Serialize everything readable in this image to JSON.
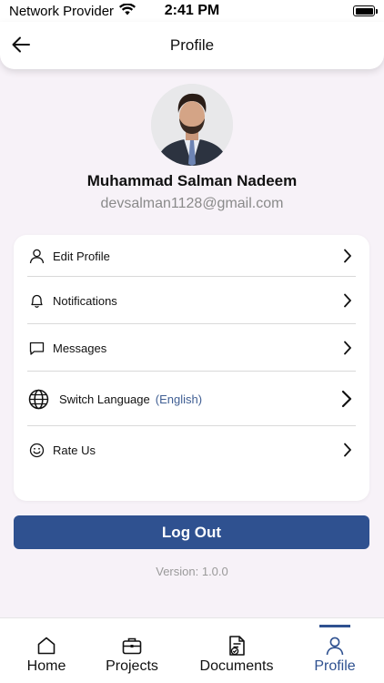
{
  "status_bar": {
    "carrier": "Network Provider",
    "time": "2:41 PM"
  },
  "header": {
    "title": "Profile",
    "back_icon": "arrow-left-icon"
  },
  "profile": {
    "name": "Muhammad Salman Nadeem",
    "email": "devsalman1128@gmail.com"
  },
  "menu": [
    {
      "label": "Edit Profile",
      "icon": "user-icon"
    },
    {
      "label": "Notifications",
      "icon": "bell-icon"
    },
    {
      "label": "Messages",
      "icon": "message-icon"
    },
    {
      "label": "Switch Language",
      "sub": "(English)",
      "icon": "globe-icon"
    },
    {
      "label": "Rate Us",
      "icon": "smile-icon"
    }
  ],
  "logout_label": "Log Out",
  "version": "Version: 1.0.0",
  "tabs": [
    {
      "label": "Home",
      "icon": "home-icon"
    },
    {
      "label": "Projects",
      "icon": "briefcase-icon"
    },
    {
      "label": "Documents",
      "icon": "document-icon"
    },
    {
      "label": "Profile",
      "icon": "person-icon",
      "active": true
    }
  ],
  "colors": {
    "primary": "#2f5190",
    "background": "#f7f2f8",
    "link": "#3f5e93"
  }
}
